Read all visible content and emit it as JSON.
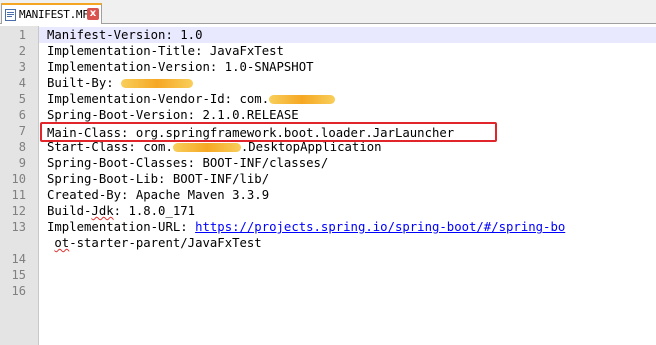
{
  "tab": {
    "title": "MANIFEST.MF",
    "close_glyph": "x"
  },
  "line_numbers": [
    "1",
    "2",
    "3",
    "4",
    "5",
    "6",
    "7",
    "8",
    "9",
    "10",
    "11",
    "12",
    "13",
    "14",
    "15",
    "16"
  ],
  "lines": {
    "l1": "Manifest-Version: 1.0",
    "l2": "Implementation-Title: JavaFxTest",
    "l3": "Implementation-Version: 1.0-SNAPSHOT",
    "l4_prefix": "Built-By: ",
    "l5_prefix": "Implementation-Vendor-Id: com.",
    "l6": "Spring-Boot-Version: 2.1.0.RELEASE",
    "l7": "Main-Class: org.springframework.boot.loader.JarLauncher",
    "l8_prefix": "Start-Class: com.",
    "l8_suffix": ".DesktopApplication",
    "l9": "Spring-Boot-Classes: BOOT-INF/classes/",
    "l10": "Spring-Boot-Lib: BOOT-INF/lib/",
    "l11": "Created-By: Apache Maven 3.3.9",
    "l12_prefix": "Build-",
    "l12_jdk": "Jdk",
    "l12_suffix": ": 1.8.0_171",
    "l13_prefix": "Implementation-URL: ",
    "l13_url": "https://projects.spring.io/spring-boot/#/spring-bo",
    "l14_pre": " ",
    "l14_ot": "ot",
    "l14_rest": "-starter-parent/JavaFxTest"
  },
  "colors": {
    "highlight_box": "#e0262b",
    "redaction": "#f59e0b",
    "link": "#0000ff"
  }
}
